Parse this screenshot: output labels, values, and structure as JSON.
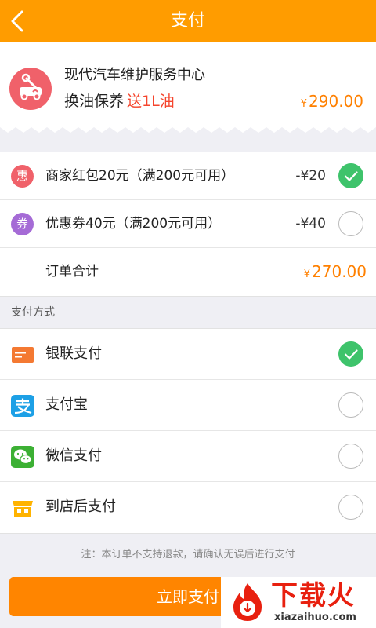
{
  "header": {
    "title": "支付"
  },
  "merchant": {
    "name": "现代汽车维护服务中心",
    "service": "换油保养",
    "gift": "送1L油",
    "currency": "¥",
    "price": "290.00"
  },
  "discounts": [
    {
      "badge": "惠",
      "label": "商家红包20元（满200元可用）",
      "amount": "-¥20",
      "checked": true,
      "color": "#f0616a"
    },
    {
      "badge": "券",
      "label": "优惠券40元（满200元可用）",
      "amount": "-¥40",
      "checked": false,
      "color": "#a56bd6"
    }
  ],
  "total": {
    "label": "订单合计",
    "currency": "¥",
    "amount": "270.00"
  },
  "payment": {
    "section_title": "支付方式",
    "methods": [
      {
        "label": "银联支付",
        "icon": "unionpay-card-icon",
        "checked": true
      },
      {
        "label": "支付宝",
        "icon": "alipay-icon",
        "checked": false
      },
      {
        "label": "微信支付",
        "icon": "wechat-icon",
        "checked": false
      },
      {
        "label": "到店后支付",
        "icon": "store-icon",
        "checked": false
      }
    ]
  },
  "note": "注：本订单不支持退款，请确认无误后进行支付",
  "submit": {
    "label": "立即支付"
  },
  "watermark": {
    "text": "下载火",
    "domain": "xiazaihuo.com"
  },
  "colors": {
    "accent": "#ff9c00",
    "price": "#ff8000",
    "check": "#3ec36b",
    "gift": "#f5452d"
  }
}
